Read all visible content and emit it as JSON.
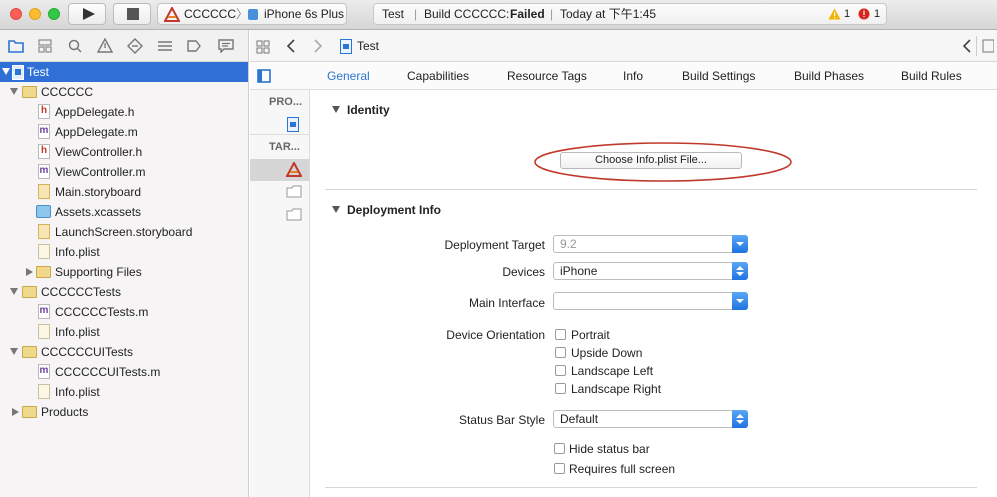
{
  "toolbar": {
    "scheme_project": "CCCCCC",
    "scheme_device": "iPhone 6s Plus",
    "activity_project": "Test",
    "activity_build": "Build CCCCCC:",
    "activity_status": "Failed",
    "activity_time": "Today at 下午1:45",
    "warning_count": "1",
    "error_count": "1"
  },
  "navigator": {
    "items": [
      {
        "label": "Test"
      },
      {
        "label": "CCCCCC"
      },
      {
        "label": "AppDelegate.h"
      },
      {
        "label": "AppDelegate.m"
      },
      {
        "label": "ViewController.h"
      },
      {
        "label": "ViewController.m"
      },
      {
        "label": "Main.storyboard"
      },
      {
        "label": "Assets.xcassets"
      },
      {
        "label": "LaunchScreen.storyboard"
      },
      {
        "label": "Info.plist"
      },
      {
        "label": "Supporting Files"
      },
      {
        "label": "CCCCCCTests"
      },
      {
        "label": "CCCCCCTests.m"
      },
      {
        "label": "Info.plist"
      },
      {
        "label": "CCCCCCUITests"
      },
      {
        "label": "CCCCCCUITests.m"
      },
      {
        "label": "Info.plist"
      },
      {
        "label": "Products"
      }
    ]
  },
  "jumpbar": {
    "file": "Test"
  },
  "tabs": [
    "General",
    "Capabilities",
    "Resource Tags",
    "Info",
    "Build Settings",
    "Build Phases",
    "Build Rules"
  ],
  "targets": {
    "project_header": "PRO...",
    "targets_header": "TAR..."
  },
  "identity": {
    "section_title": "Identity",
    "choose_button": "Choose Info.plist File..."
  },
  "deployment": {
    "section_title": "Deployment Info",
    "deployment_target_label": "Deployment Target",
    "deployment_target_value": "9.2",
    "devices_label": "Devices",
    "devices_value": "iPhone",
    "main_interface_label": "Main Interface",
    "main_interface_value": "",
    "orientation_label": "Device Orientation",
    "orientations": [
      "Portrait",
      "Upside Down",
      "Landscape Left",
      "Landscape Right"
    ],
    "status_bar_label": "Status Bar Style",
    "status_bar_value": "Default",
    "hide_status_bar": "Hide status bar",
    "requires_full_screen": "Requires full screen"
  },
  "colors": {
    "accent": "#2a74d4",
    "selection": "#2f6fd6",
    "annotation": "#c0392b",
    "warning": "#f0b400",
    "error": "#d9251d"
  }
}
